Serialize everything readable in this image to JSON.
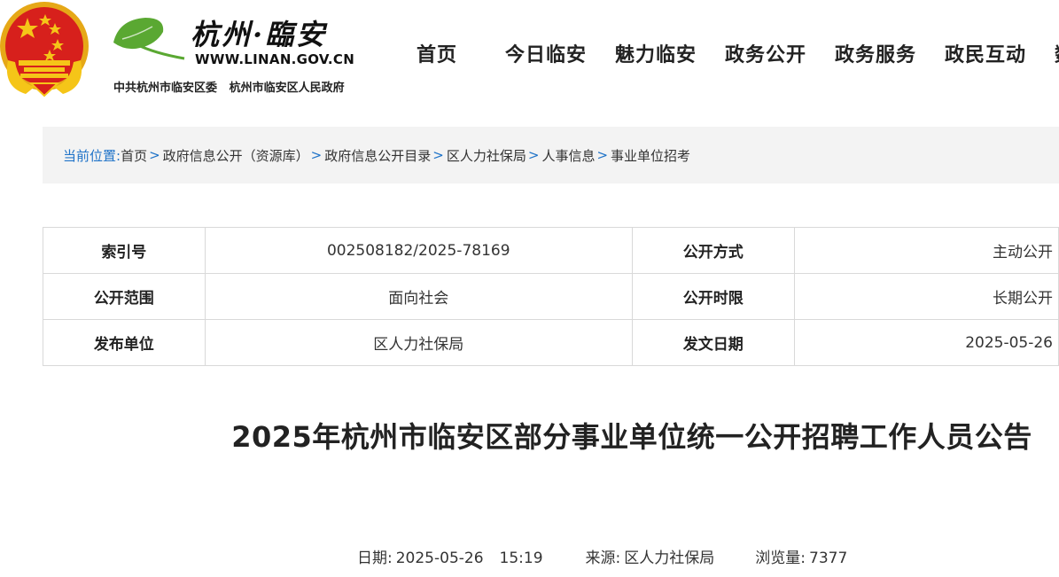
{
  "header": {
    "site_name": "杭州·臨安",
    "site_url": "WWW.LINAN.GOV.CN",
    "orgs": "中共杭州市临安区委   杭州市临安区人民政府",
    "nav": [
      "首页",
      "今日临安",
      "魅力临安",
      "政务公开",
      "政务服务",
      "政民互动",
      "数"
    ],
    "colors": {
      "emblem_red": "#d7201c",
      "emblem_gold": "#f5c518",
      "leaf_green": "#5aa832"
    }
  },
  "breadcrumb": {
    "label": "当前位置:",
    "items": [
      "首页",
      "政府信息公开（资源库）",
      "政府信息公开目录",
      "区人力社保局",
      "人事信息",
      "事业单位招考"
    ],
    "separator": ">"
  },
  "info": {
    "rows": [
      {
        "k1": "索引号",
        "v1": "002508182/2025-78169",
        "k2": "公开方式",
        "v2": "主动公开"
      },
      {
        "k1": "公开范围",
        "v1": "面向社会",
        "k2": "公开时限",
        "v2": "长期公开"
      },
      {
        "k1": "发布单位",
        "v1": "区人力社保局",
        "k2": "发文日期",
        "v2": "2025-05-26"
      }
    ]
  },
  "article": {
    "title": "2025年杭州市临安区部分事业单位统一公开招聘工作人员公告",
    "date_label": "日期:",
    "date": "2025-05-26",
    "time": "15:19",
    "source_label": "来源:",
    "source": "区人力社保局",
    "views_label": "浏览量:",
    "views": "7377"
  }
}
